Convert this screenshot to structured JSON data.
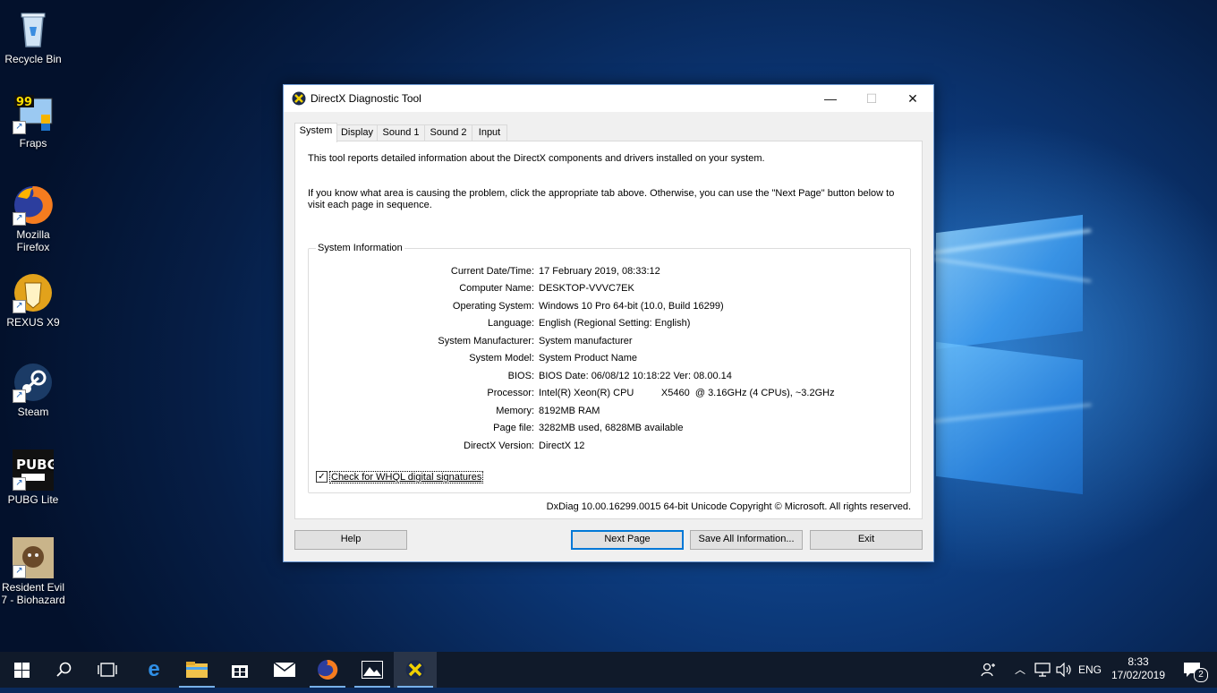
{
  "desktop": {
    "icons": [
      {
        "label": "Recycle Bin"
      },
      {
        "label": "Fraps"
      },
      {
        "label": "Mozilla Firefox"
      },
      {
        "label": "REXUS X9"
      },
      {
        "label": "Steam"
      },
      {
        "label": "PUBG Lite"
      },
      {
        "label": "Resident Evil 7 - Biohazard"
      }
    ]
  },
  "window": {
    "title": "DirectX Diagnostic Tool",
    "controls": {
      "minimize": "—",
      "maximize": "☐",
      "close": "✕"
    },
    "tabs": [
      {
        "label": "System",
        "active": true
      },
      {
        "label": "Display",
        "active": false
      },
      {
        "label": "Sound 1",
        "active": false
      },
      {
        "label": "Sound 2",
        "active": false
      },
      {
        "label": "Input",
        "active": false
      }
    ],
    "intro_line1": "This tool reports detailed information about the DirectX components and drivers installed on your system.",
    "intro_line2a": "If you know what area is causing the problem, click the appropriate tab above.  Otherwise, you can use the \"Next Page\" button below to",
    "intro_line2b": "visit each page in sequence.",
    "group_title": "System Information",
    "system_info": [
      {
        "label": "Current Date/Time:",
        "value": "17 February 2019, 08:33:12"
      },
      {
        "label": "Computer Name:",
        "value": "DESKTOP-VVVC7EK"
      },
      {
        "label": "Operating System:",
        "value": "Windows 10 Pro 64-bit (10.0, Build 16299)"
      },
      {
        "label": "Language:",
        "value": "English (Regional Setting: English)"
      },
      {
        "label": "System Manufacturer:",
        "value": "System manufacturer"
      },
      {
        "label": "System Model:",
        "value": "System Product Name"
      },
      {
        "label": "BIOS:",
        "value": "BIOS Date: 06/08/12 10:18:22 Ver: 08.00.14"
      },
      {
        "label": "Processor:",
        "value": "Intel(R) Xeon(R) CPU          X5460  @ 3.16GHz (4 CPUs), ~3.2GHz"
      },
      {
        "label": "Memory:",
        "value": "8192MB RAM"
      },
      {
        "label": "Page file:",
        "value": "3282MB used, 6828MB available"
      },
      {
        "label": "DirectX Version:",
        "value": "DirectX 12"
      }
    ],
    "whql_checkbox": {
      "label": "Check for WHQL digital signatures",
      "checked": true
    },
    "footer": "DxDiag 10.00.16299.0015 64-bit Unicode  Copyright © Microsoft. All rights reserved.",
    "buttons": {
      "help": "Help",
      "next_page": "Next Page",
      "save_all": "Save All Information...",
      "exit": "Exit"
    }
  },
  "taskbar": {
    "apps": [
      "start-icon",
      "search-icon",
      "task-view-icon",
      "edge-icon",
      "file-explorer-icon",
      "store-icon",
      "mail-icon",
      "firefox-icon",
      "photos-icon",
      "dxdiag-icon"
    ],
    "language": "ENG",
    "time": "8:33",
    "date": "17/02/2019",
    "notification_count": "2"
  }
}
